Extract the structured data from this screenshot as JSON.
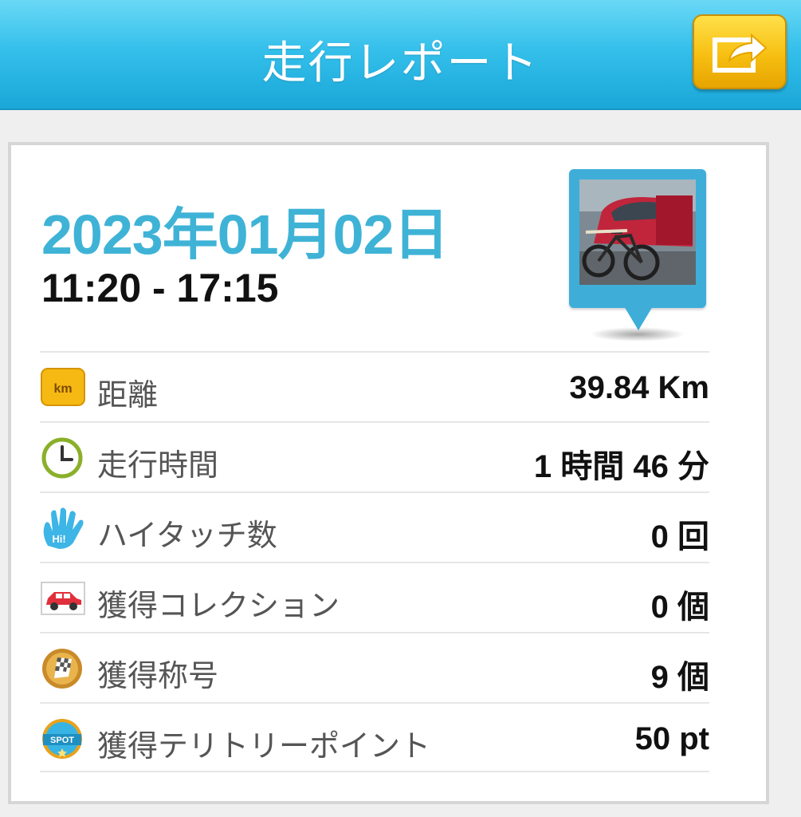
{
  "header": {
    "title": "走行レポート",
    "share_icon": "share-arrow-icon"
  },
  "report": {
    "date": "2023年01月02日",
    "time_range": "11:20 - 17:15",
    "photo_icon": "ride-photo-thumbnail"
  },
  "stats": [
    {
      "icon": "km-icon",
      "icon_text": "km",
      "label": "距離",
      "value": "39.84 Km"
    },
    {
      "icon": "clock-icon",
      "label": "走行時間",
      "value": "1 時間 46 分"
    },
    {
      "icon": "hand-hi-icon",
      "icon_text": "Hi!",
      "label": "ハイタッチ数",
      "value": "0 回"
    },
    {
      "icon": "car-icon",
      "label": "獲得コレクション",
      "value": "0 個"
    },
    {
      "icon": "checkered-flag-medal-icon",
      "label": "獲得称号",
      "value": "9 個"
    },
    {
      "icon": "spot-badge-icon",
      "icon_text": "SPOT",
      "label": "獲得テリトリーポイント",
      "value": "50 pt"
    }
  ],
  "colors": {
    "header": "#35c0eb",
    "accent_date": "#3fb3d6",
    "share_button": "#f7bf12"
  }
}
